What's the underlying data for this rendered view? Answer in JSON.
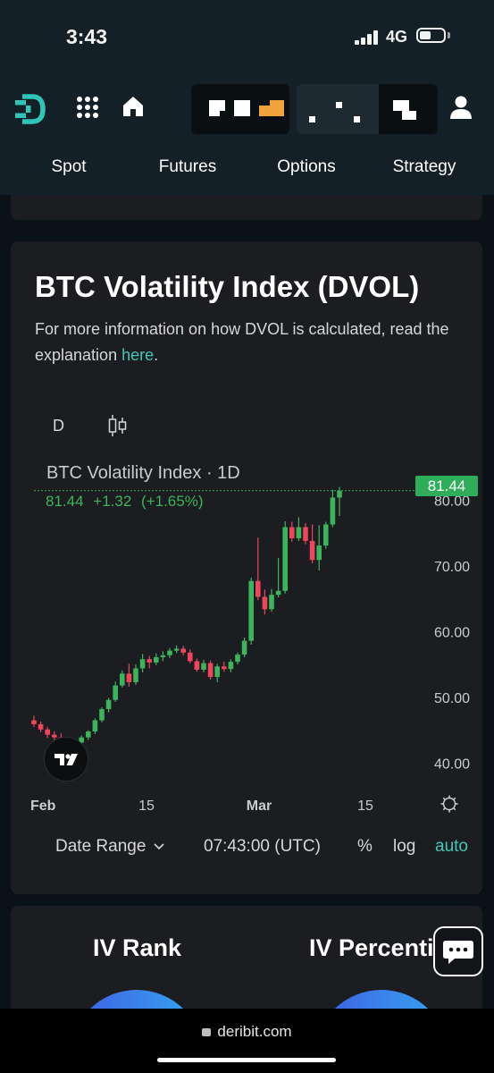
{
  "status_bar": {
    "time": "3:43",
    "network": "4G"
  },
  "nav": {
    "tabs": [
      {
        "label": "Spot",
        "active": false
      },
      {
        "label": "Futures",
        "active": false
      },
      {
        "label": "Options",
        "active": true
      },
      {
        "label": "Strategy",
        "active": false
      }
    ]
  },
  "dvol": {
    "title": "BTC Volatility Index (DVOL)",
    "description": "For more information on how DVOL is calculated, read the explanation ",
    "link_text": "here",
    "description_end": ".",
    "interval": "D",
    "legend_title": "BTC Volatility Index · 1D",
    "last_value": "81.44",
    "change": "+1.32",
    "change_pct": "(+1.65%)",
    "price_tag": "81.44",
    "toolbar": {
      "date_range": "Date Range",
      "time": "07:43:00 (UTC)",
      "percent": "%",
      "log": "log",
      "auto": "auto"
    }
  },
  "chart_data": {
    "type": "candlestick",
    "title": "BTC Volatility Index · 1D",
    "x_ticks": [
      "Feb",
      "15",
      "Mar",
      "15"
    ],
    "y_ticks": [
      40,
      50,
      60,
      70,
      80
    ],
    "y_tick_labels": [
      "40.00",
      "50.00",
      "60.00",
      "70.00",
      "80.00"
    ],
    "ylim": [
      38,
      84
    ],
    "last_value": 81.44,
    "up_color": "#3bb55c",
    "down_color": "#f0455d",
    "series": [
      {
        "o": 46.5,
        "h": 47.2,
        "l": 45.5,
        "c": 45.9
      },
      {
        "o": 45.9,
        "h": 46.3,
        "l": 44.7,
        "c": 45.1
      },
      {
        "o": 45.1,
        "h": 45.5,
        "l": 43.8,
        "c": 44.3
      },
      {
        "o": 44.3,
        "h": 44.8,
        "l": 43.5,
        "c": 43.9
      },
      {
        "o": 43.9,
        "h": 44.5,
        "l": 42.9,
        "c": 43.2
      },
      {
        "o": 43.2,
        "h": 43.6,
        "l": 42.2,
        "c": 42.6
      },
      {
        "o": 42.6,
        "h": 43.4,
        "l": 42.0,
        "c": 43.1
      },
      {
        "o": 43.1,
        "h": 44.2,
        "l": 42.8,
        "c": 43.9
      },
      {
        "o": 43.9,
        "h": 45.0,
        "l": 43.5,
        "c": 44.8
      },
      {
        "o": 44.8,
        "h": 46.8,
        "l": 44.4,
        "c": 46.5
      },
      {
        "o": 46.5,
        "h": 48.5,
        "l": 46.2,
        "c": 48.2
      },
      {
        "o": 48.2,
        "h": 49.9,
        "l": 47.7,
        "c": 49.6
      },
      {
        "o": 49.6,
        "h": 52.4,
        "l": 49.3,
        "c": 51.8
      },
      {
        "o": 51.8,
        "h": 54.1,
        "l": 51.5,
        "c": 53.6
      },
      {
        "o": 53.6,
        "h": 55.1,
        "l": 51.6,
        "c": 52.3
      },
      {
        "o": 52.3,
        "h": 55.0,
        "l": 51.9,
        "c": 54.4
      },
      {
        "o": 54.4,
        "h": 56.6,
        "l": 53.8,
        "c": 55.8
      },
      {
        "o": 55.8,
        "h": 56.3,
        "l": 54.4,
        "c": 55.3
      },
      {
        "o": 55.3,
        "h": 56.7,
        "l": 54.9,
        "c": 56.1
      },
      {
        "o": 56.1,
        "h": 57.0,
        "l": 55.5,
        "c": 56.4
      },
      {
        "o": 56.4,
        "h": 57.5,
        "l": 56.0,
        "c": 57.1
      },
      {
        "o": 57.1,
        "h": 57.9,
        "l": 56.7,
        "c": 57.4
      },
      {
        "o": 57.4,
        "h": 57.8,
        "l": 56.4,
        "c": 56.8
      },
      {
        "o": 56.8,
        "h": 57.3,
        "l": 55.2,
        "c": 55.5
      },
      {
        "o": 55.5,
        "h": 55.9,
        "l": 53.9,
        "c": 54.2
      },
      {
        "o": 54.2,
        "h": 55.7,
        "l": 53.8,
        "c": 55.2
      },
      {
        "o": 55.2,
        "h": 55.6,
        "l": 52.7,
        "c": 53.1
      },
      {
        "o": 53.1,
        "h": 55.1,
        "l": 52.3,
        "c": 54.7
      },
      {
        "o": 54.7,
        "h": 55.4,
        "l": 53.9,
        "c": 54.3
      },
      {
        "o": 54.3,
        "h": 55.8,
        "l": 53.8,
        "c": 55.4
      },
      {
        "o": 55.4,
        "h": 56.8,
        "l": 55.0,
        "c": 56.5
      },
      {
        "o": 56.5,
        "h": 59.1,
        "l": 56.1,
        "c": 58.6
      },
      {
        "o": 58.6,
        "h": 68.2,
        "l": 58.0,
        "c": 67.7
      },
      {
        "o": 67.7,
        "h": 74.3,
        "l": 64.8,
        "c": 65.3
      },
      {
        "o": 65.3,
        "h": 66.4,
        "l": 62.6,
        "c": 63.4
      },
      {
        "o": 63.4,
        "h": 66.5,
        "l": 63.0,
        "c": 65.6
      },
      {
        "o": 65.6,
        "h": 71.2,
        "l": 65.2,
        "c": 66.2
      },
      {
        "o": 66.2,
        "h": 76.8,
        "l": 65.8,
        "c": 75.9
      },
      {
        "o": 75.9,
        "h": 76.7,
        "l": 73.7,
        "c": 74.2
      },
      {
        "o": 74.2,
        "h": 77.4,
        "l": 73.8,
        "c": 75.9
      },
      {
        "o": 75.9,
        "h": 76.5,
        "l": 73.3,
        "c": 73.8
      },
      {
        "o": 73.8,
        "h": 76.3,
        "l": 70.4,
        "c": 70.9
      },
      {
        "o": 70.9,
        "h": 76.2,
        "l": 69.3,
        "c": 73.1
      },
      {
        "o": 73.1,
        "h": 76.7,
        "l": 72.6,
        "c": 76.3
      },
      {
        "o": 76.3,
        "h": 81.6,
        "l": 75.9,
        "c": 80.4
      },
      {
        "o": 80.4,
        "h": 82.0,
        "l": 77.6,
        "c": 81.44
      }
    ]
  },
  "iv_cards": {
    "rank_title": "IV Rank",
    "percentile_title": "IV Percenti"
  },
  "browser": {
    "url": "deribit.com"
  }
}
